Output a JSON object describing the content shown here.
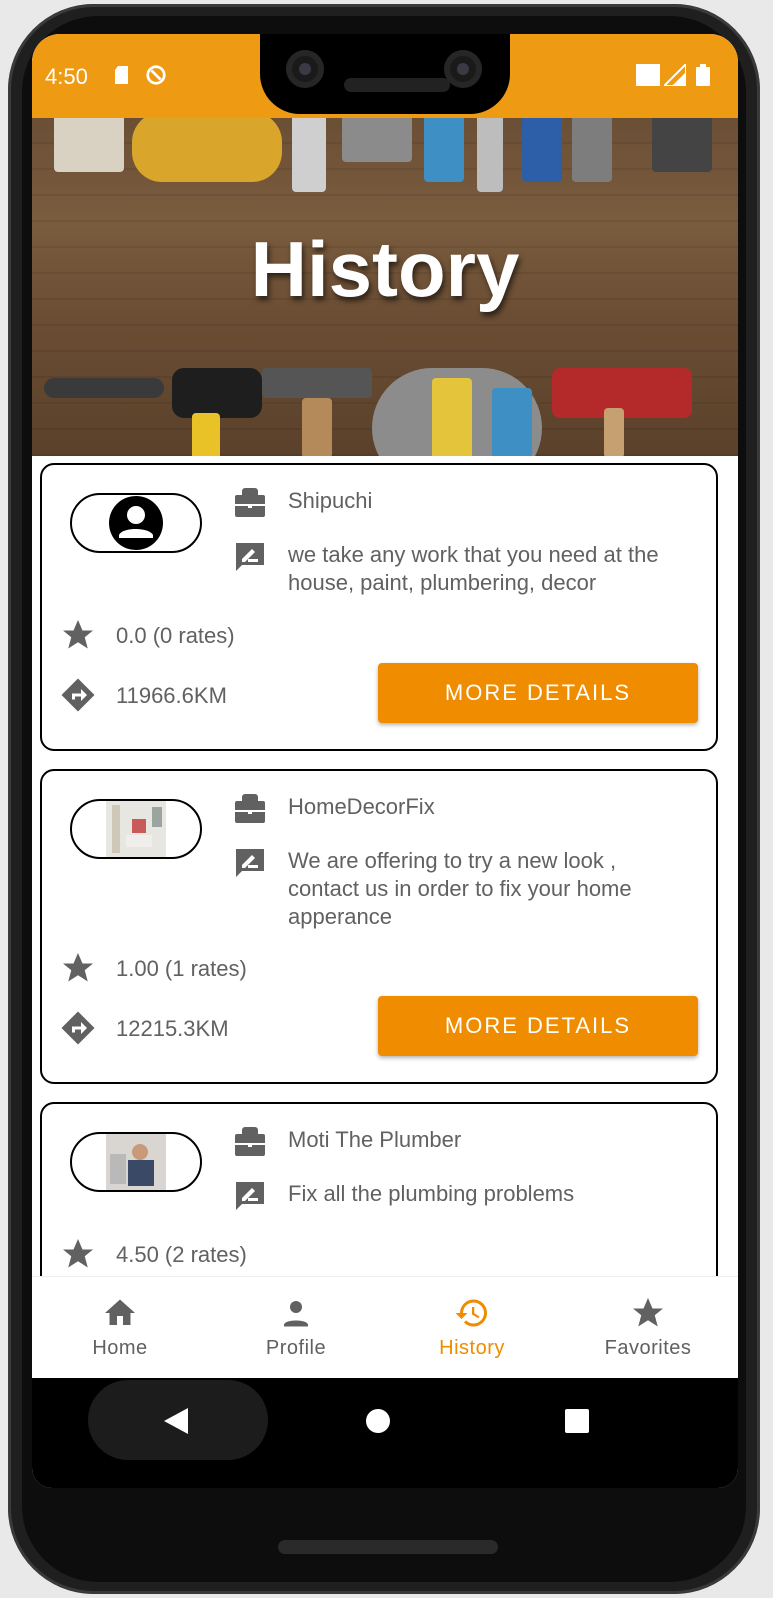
{
  "status_bar": {
    "time": "4:50"
  },
  "header": {
    "title": "History"
  },
  "cards": [
    {
      "name": "Shipuchi",
      "description": "we take any work that you need at the house, paint, plumbering, decor",
      "rating": "0.0 (0 rates)",
      "distance": "11966.6KM",
      "button_label": "MORE DETAILS",
      "avatar": "person-placeholder"
    },
    {
      "name": "HomeDecorFix",
      "description": "We are offering to try a new look , contact us in order to fix your home apperance",
      "rating": "1.00 (1 rates)",
      "distance": "12215.3KM",
      "button_label": "MORE DETAILS",
      "avatar": "room-photo"
    },
    {
      "name": "Moti The Plumber",
      "description": "Fix all the plumbing problems",
      "rating": "4.50 (2 rates)",
      "avatar": "plumber-photo"
    }
  ],
  "bottom_nav": [
    {
      "label": "Home",
      "icon": "home-icon",
      "active": false
    },
    {
      "label": "Profile",
      "icon": "person-icon",
      "active": false
    },
    {
      "label": "History",
      "icon": "history-icon",
      "active": true
    },
    {
      "label": "Favorites",
      "icon": "star-icon",
      "active": false
    }
  ],
  "colors": {
    "accent": "#ef8c00",
    "status_bar": "#ef9a13",
    "text_grey": "#616161"
  }
}
